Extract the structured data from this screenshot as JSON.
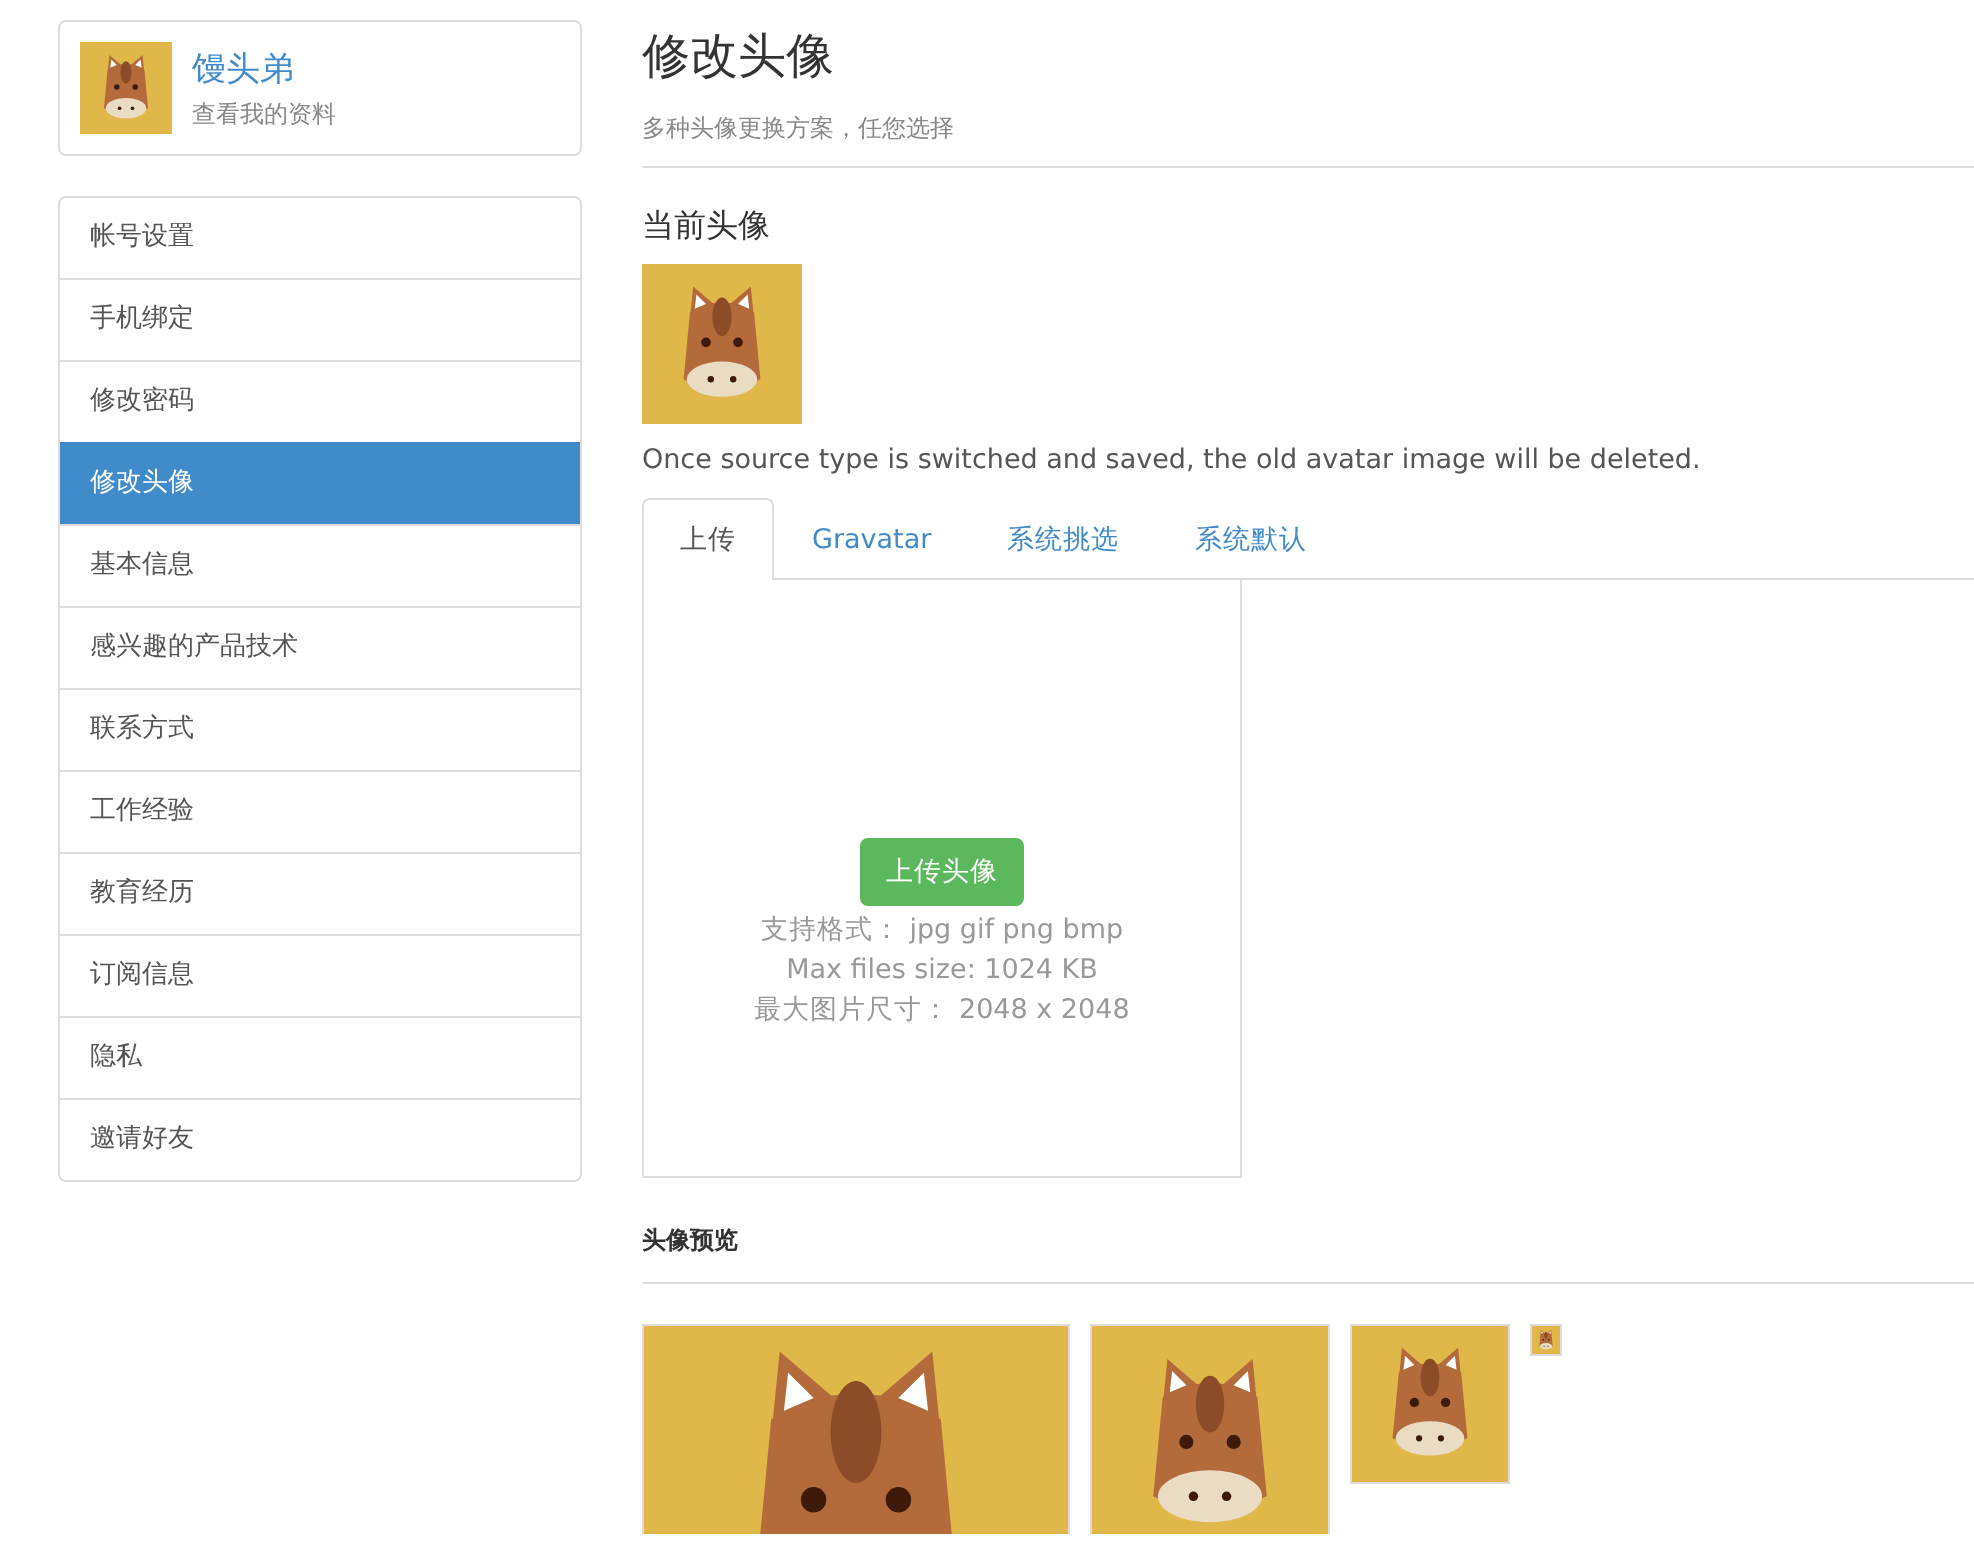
{
  "profile": {
    "name": "馒头弟",
    "link": "查看我的资料"
  },
  "menu": [
    {
      "label": "帐号设置",
      "selected": false
    },
    {
      "label": "手机绑定",
      "selected": false
    },
    {
      "label": "修改密码",
      "selected": false
    },
    {
      "label": "修改头像",
      "selected": true
    },
    {
      "label": "基本信息",
      "selected": false
    },
    {
      "label": "感兴趣的产品技术",
      "selected": false
    },
    {
      "label": "联系方式",
      "selected": false
    },
    {
      "label": "工作经验",
      "selected": false
    },
    {
      "label": "教育经历",
      "selected": false
    },
    {
      "label": "订阅信息",
      "selected": false
    },
    {
      "label": "隐私",
      "selected": false
    },
    {
      "label": "邀请好友",
      "selected": false
    }
  ],
  "page": {
    "title": "修改头像",
    "subtitle": "多种头像更换方案，任您选择"
  },
  "current": {
    "title": "当前头像",
    "notice": "Once source type is switched and saved, the old avatar image will be deleted."
  },
  "tabs": [
    {
      "label": "上传",
      "selected": true
    },
    {
      "label": "Gravatar",
      "selected": false
    },
    {
      "label": "系统挑选",
      "selected": false
    },
    {
      "label": "系统默认",
      "selected": false
    }
  ],
  "upload": {
    "button": "上传头像",
    "lines": [
      "支持格式：  jpg gif png bmp",
      "Max files size: 1024 KB",
      "最大图片尺寸：  2048 x 2048"
    ]
  },
  "preview": {
    "title": "头像预览"
  }
}
